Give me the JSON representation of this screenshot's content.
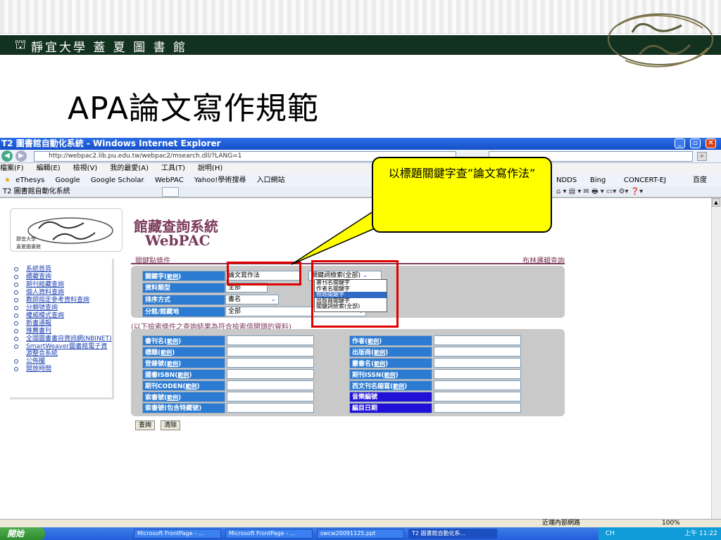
{
  "slide": {
    "library_name": "靜宜大學 蓋 夏 圖 書 館",
    "logo_glyph": "⛫",
    "title": "APA論文寫作規範",
    "callout": "以標題關鍵字查”論文寫作法”"
  },
  "browser": {
    "window_title": "T2 圖書館自動化系統 - Windows Internet Explorer",
    "url": "http://webpac2.lib.pu.edu.tw/webpac2/msearch.dll/?LANG=1",
    "menu": [
      "檔案(F)",
      "編輯(E)",
      "檢視(V)",
      "我的最愛(A)",
      "工具(T)",
      "說明(H)"
    ],
    "favorites": [
      "eThesys",
      "Google",
      "Google Scholar",
      "WebPAC",
      "Yahoo!學術搜尋",
      "入口網站",
      "NDDS",
      "Bing",
      "CONCERT-EJ",
      "百度"
    ],
    "tab_title": "T2 圖書館自動化系統",
    "status_zone": "近端內部網路",
    "zoom": "100%"
  },
  "taskbar": {
    "start": "開始",
    "items": [
      "Microsoft FrontPage - ...",
      "Microsoft FrontPage - ...",
      "swcw20091125.ppt",
      "T2 圖書館自動化系..."
    ],
    "clock": "上午 11:22",
    "ime": "CH"
  },
  "webpac": {
    "header_line1": "館藏查詢系統",
    "header_line2": "WebPAC",
    "school_small1": "靜宜大學",
    "school_small2": "蓋夏圖書館",
    "side_menu": [
      "系統首頁",
      "續藏查詢",
      "期刊館藏查詢",
      "個人資料查詢",
      "教師指定參考資料查詢",
      "分類號查詢",
      "權威模式查詢",
      "新書通報",
      "推薦書刊",
      "全國圖書書目資訊網(NBINET)",
      "SmartWeaver圖書館電子資源整合系統",
      "公佈欄",
      "開放時間"
    ],
    "section_title": "關鍵點條件",
    "boolean_link": "布林邏輯查詢",
    "example": "範例",
    "rows": {
      "keyword_label": "關鍵字",
      "keyword_value": "論文寫作法",
      "keyword_type_selected": "關鍵詞檢索(全部)",
      "doctype_label": "資料類型",
      "doctype_value": "全部",
      "sort_label": "排序方式",
      "sort_value": "書名",
      "branch_label": "分館/館藏地",
      "branch_value": "全部"
    },
    "dropdown_options": [
      "書刊名關鍵字",
      "作者名關鍵字",
      "標題關鍵字",
      "出版商關鍵字",
      "關鍵詞檢索(全部)"
    ],
    "note": "(以下檢索條件之查詢結果為符合檢索值開頭的資料)",
    "left_fields": [
      "書刊名",
      "標題",
      "登錄號",
      "國書ISBN",
      "期刊CODEN",
      "索書號",
      "索書號(包含特藏號)"
    ],
    "right_fields": [
      "作者",
      "出版商",
      "叢書名",
      "期刊ISSN",
      "西文刊名縮寫",
      "音樂編號",
      "編目日期"
    ],
    "buttons": [
      "查詢",
      "清除"
    ]
  }
}
